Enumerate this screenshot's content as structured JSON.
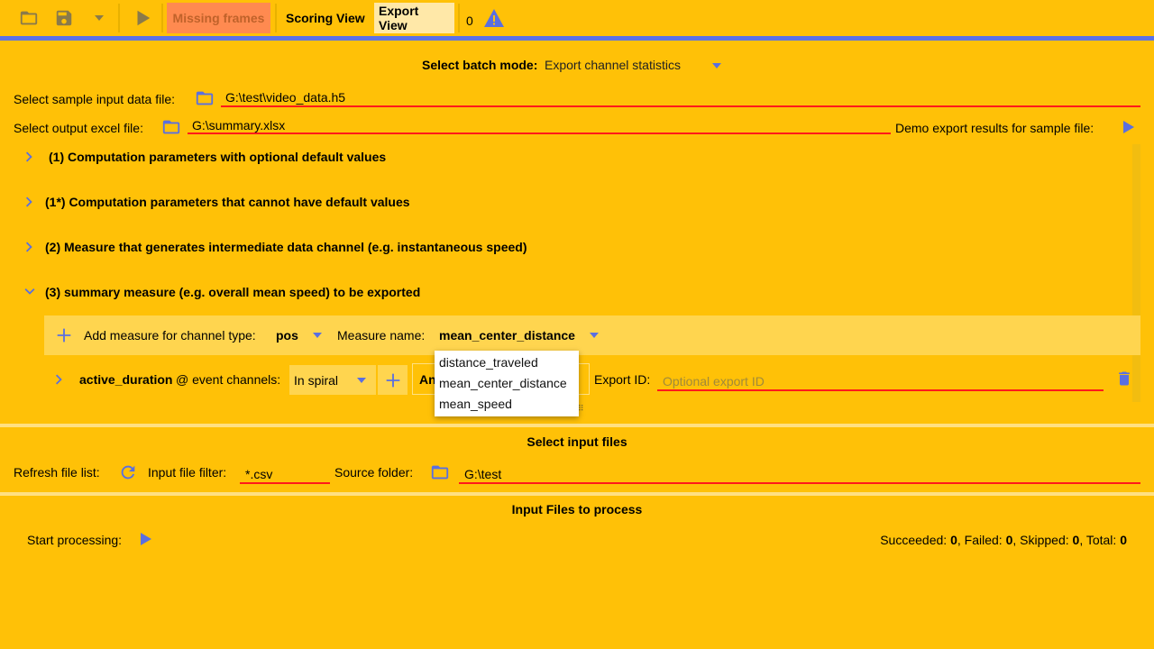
{
  "toolbar": {
    "missing_frames_label": "Missing frames",
    "scoring_view_label": "Scoring View",
    "export_view_label": "Export View",
    "warning_count": "0",
    "icons": [
      "folder-open-icon",
      "save-icon",
      "dropdown-arrow-icon",
      "play-icon",
      "warning-icon"
    ]
  },
  "batch": {
    "label": "Select batch mode:",
    "value": "Export channel statistics"
  },
  "sample_input": {
    "label": "Select sample input data file:",
    "value": "G:\\test\\video_data.h5"
  },
  "output_excel": {
    "label": "Select output excel file:",
    "value": "G:\\summary.xlsx",
    "demo_label": "Demo export results for sample file:"
  },
  "sections": [
    {
      "title": "(1) Computation parameters with optional default values",
      "expanded": false
    },
    {
      "title": "(1*) Computation parameters that cannot have default values",
      "expanded": false
    },
    {
      "title": "(2) Measure that generates intermediate data channel (e.g. instantaneous speed)",
      "expanded": false
    },
    {
      "title": "(3) summary measure (e.g. overall mean speed) to be exported",
      "expanded": true
    }
  ],
  "measure_bar": {
    "add_label": "Add measure for channel type:",
    "channel_type": "pos",
    "measure_name_label": "Measure name:",
    "measure_name": "mean_center_distance"
  },
  "measure_row": {
    "name": "active_duration",
    "event_label": "@ event channels:",
    "event_value": "In spiral",
    "logic_partial": "An",
    "export_id_label": "Export ID:",
    "export_id_placeholder": "Optional export ID"
  },
  "dropdown_options": [
    "distance_traveled",
    "mean_center_distance",
    "mean_speed"
  ],
  "input_files": {
    "heading": "Select input files",
    "refresh_label": "Refresh file list:",
    "filter_label": "Input file filter:",
    "filter_value": "*.csv",
    "source_label": "Source folder:",
    "source_value": "G:\\test"
  },
  "process": {
    "heading": "Input Files to process",
    "start_label": "Start processing:",
    "succeeded_label": "Succeeded:",
    "succeeded": "0",
    "failed_label": "Failed:",
    "failed": "0",
    "skipped_label": "Skipped:",
    "skipped": "0",
    "total_label": "Total:",
    "total": "0"
  },
  "colors": {
    "background": "#ffc107",
    "accent_blue": "#5b72e6",
    "field_underline": "#ff1a1a",
    "missing_frames_bg": "#ff8a50"
  }
}
